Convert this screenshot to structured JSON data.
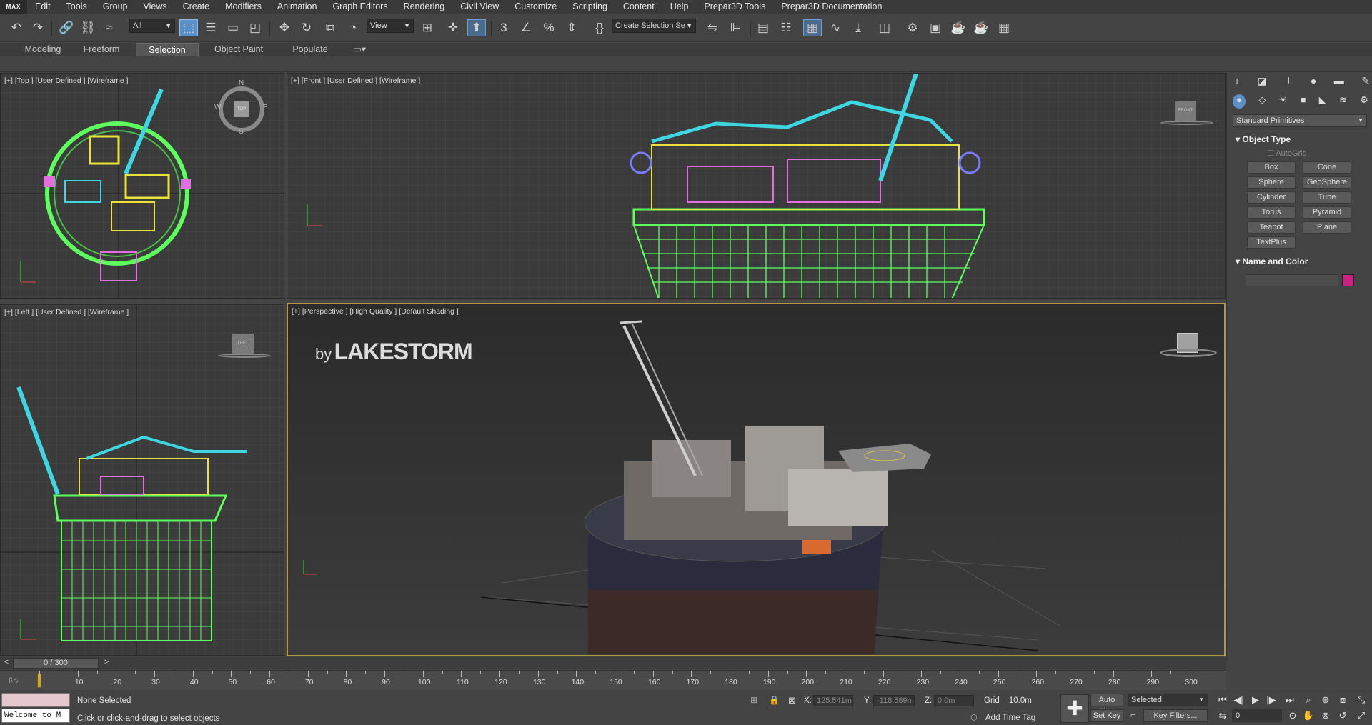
{
  "menu": {
    "logo": "MAX",
    "items": [
      "Edit",
      "Tools",
      "Group",
      "Views",
      "Create",
      "Modifiers",
      "Animation",
      "Graph Editors",
      "Rendering",
      "Civil View",
      "Customize",
      "Scripting",
      "Content",
      "Help",
      "Prepar3D Tools",
      "Prepar3D Documentation"
    ]
  },
  "toolbar": {
    "filter_value": "All",
    "ref_coord_value": "View",
    "selection_set_value": "Create Selection Se"
  },
  "ribbon": {
    "tabs": [
      "Modeling",
      "Freeform",
      "Selection",
      "Object Paint",
      "Populate"
    ],
    "active_tab": "Selection"
  },
  "viewports": {
    "top": "[+] [Top ] [User Defined ] [Wireframe ]",
    "front": "[+] [Front ] [User Defined ] [Wireframe ]",
    "left": "[+] [Left ] [User Defined ] [Wireframe ]",
    "perspective": "[+] [Perspective ] [High Quality ] [Default Shading ]"
  },
  "compass": {
    "n": "N",
    "e": "E",
    "s": "S",
    "w": "W",
    "cube": "TOP"
  },
  "viewcube": {
    "front": "FRONT",
    "left": "LEFT"
  },
  "watermark": {
    "by": "by",
    "name": "LAKESTORM"
  },
  "command_panel": {
    "category": "Standard Primitives",
    "object_type_title": "Object Type",
    "autogrid": "AutoGrid",
    "buttons": [
      "Box",
      "Cone",
      "Sphere",
      "GeoSphere",
      "Cylinder",
      "Tube",
      "Torus",
      "Pyramid",
      "Teapot",
      "Plane",
      "TextPlus"
    ],
    "name_color_title": "Name and Color",
    "color": "#c8237e"
  },
  "timeline": {
    "slider_label": "0 / 300",
    "ticks": [
      "10",
      "20",
      "30",
      "40",
      "50",
      "60",
      "70",
      "80",
      "90",
      "100",
      "110",
      "120",
      "130",
      "140",
      "150",
      "160",
      "170",
      "180",
      "190",
      "200",
      "210",
      "220",
      "230",
      "240",
      "250",
      "260",
      "270",
      "280",
      "290",
      "300"
    ]
  },
  "status": {
    "maxscript": "Welcome to M",
    "selection": "None Selected",
    "prompt": "Click or click-and-drag to select objects",
    "x_label": "X:",
    "x_value": "125.541m",
    "y_label": "Y:",
    "y_value": "-118.589m",
    "z_label": "Z:",
    "z_value": "0.0m",
    "grid": "Grid = 10.0m",
    "add_time_tag": "Add Time Tag",
    "auto_key": "Auto Key",
    "selected": "Selected",
    "set_key": "Set Key",
    "key_filters": "Key Filters...",
    "frame": "0"
  },
  "colors": {
    "accent": "#5b8fc7",
    "active_viewport": "#b49a3c",
    "wire_green": "#5cff5c",
    "wire_cyan": "#3ed6e0",
    "wire_yellow": "#e8e23a",
    "wire_pink": "#e070e0"
  }
}
